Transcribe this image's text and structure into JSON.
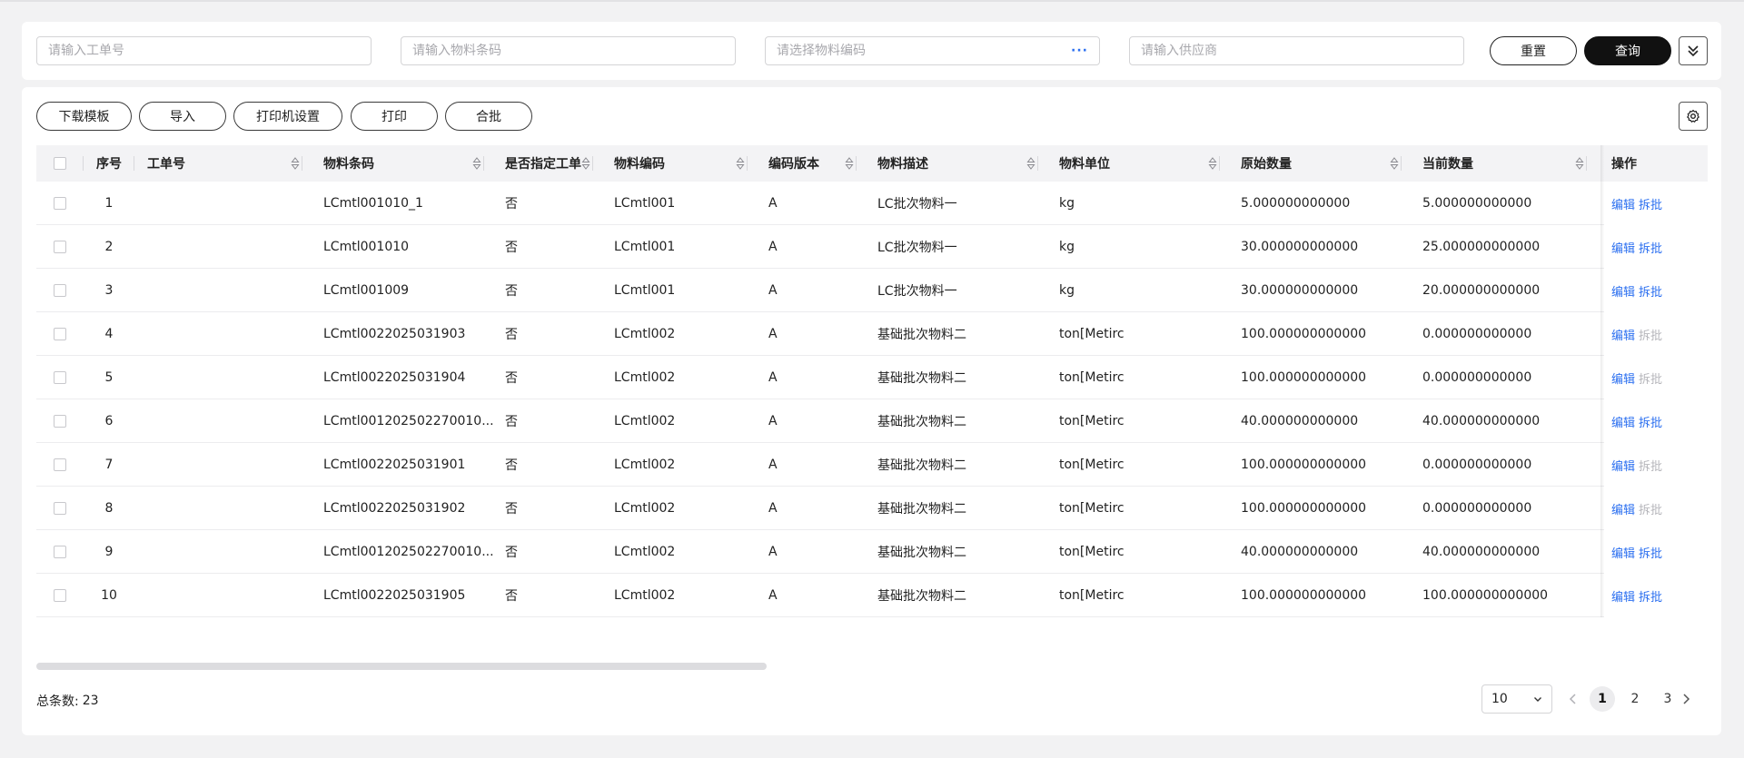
{
  "filters": {
    "work_order_placeholder": "请输入工单号",
    "material_barcode_placeholder": "请输入物料条码",
    "material_code_placeholder": "请选择物料编码",
    "supplier_placeholder": "请输入供应商",
    "reset_label": "重置",
    "query_label": "查询"
  },
  "toolbar": {
    "download_template": "下载模板",
    "import": "导入",
    "printer_settings": "打印机设置",
    "print": "打印",
    "merge_batch": "合批"
  },
  "table": {
    "columns": {
      "index": "序号",
      "work_order": "工单号",
      "material_barcode": "物料条码",
      "is_assigned_order": "是否指定工单",
      "material_code": "物料编码",
      "code_version": "编码版本",
      "material_desc": "物料描述",
      "material_unit": "物料单位",
      "original_qty": "原始数量",
      "current_qty": "当前数量",
      "actions": "操作"
    },
    "edit_label": "编辑",
    "split_label": "拆批",
    "rows": [
      {
        "index": "1",
        "work_order": "",
        "barcode": "LCmtl001010_1",
        "assigned": "否",
        "code": "LCmtl001",
        "version": "A",
        "desc": "LC批次物料一",
        "unit": "kg",
        "orig": "5.000000000000",
        "curr": "5.000000000000",
        "split_enabled": true
      },
      {
        "index": "2",
        "work_order": "",
        "barcode": "LCmtl001010",
        "assigned": "否",
        "code": "LCmtl001",
        "version": "A",
        "desc": "LC批次物料一",
        "unit": "kg",
        "orig": "30.000000000000",
        "curr": "25.000000000000",
        "split_enabled": true
      },
      {
        "index": "3",
        "work_order": "",
        "barcode": "LCmtl001009",
        "assigned": "否",
        "code": "LCmtl001",
        "version": "A",
        "desc": "LC批次物料一",
        "unit": "kg",
        "orig": "30.000000000000",
        "curr": "20.000000000000",
        "split_enabled": true
      },
      {
        "index": "4",
        "work_order": "",
        "barcode": "LCmtl0022025031903",
        "assigned": "否",
        "code": "LCmtl002",
        "version": "A",
        "desc": "基础批次物料二",
        "unit": "ton[Metirc",
        "orig": "100.000000000000",
        "curr": "0.000000000000",
        "split_enabled": false
      },
      {
        "index": "5",
        "work_order": "",
        "barcode": "LCmtl0022025031904",
        "assigned": "否",
        "code": "LCmtl002",
        "version": "A",
        "desc": "基础批次物料二",
        "unit": "ton[Metirc",
        "orig": "100.000000000000",
        "curr": "0.000000000000",
        "split_enabled": false
      },
      {
        "index": "6",
        "work_order": "",
        "barcode": "LCmtl001202502270010...",
        "assigned": "否",
        "code": "LCmtl002",
        "version": "A",
        "desc": "基础批次物料二",
        "unit": "ton[Metirc",
        "orig": "40.000000000000",
        "curr": "40.000000000000",
        "split_enabled": true
      },
      {
        "index": "7",
        "work_order": "",
        "barcode": "LCmtl0022025031901",
        "assigned": "否",
        "code": "LCmtl002",
        "version": "A",
        "desc": "基础批次物料二",
        "unit": "ton[Metirc",
        "orig": "100.000000000000",
        "curr": "0.000000000000",
        "split_enabled": false
      },
      {
        "index": "8",
        "work_order": "",
        "barcode": "LCmtl0022025031902",
        "assigned": "否",
        "code": "LCmtl002",
        "version": "A",
        "desc": "基础批次物料二",
        "unit": "ton[Metirc",
        "orig": "100.000000000000",
        "curr": "0.000000000000",
        "split_enabled": false
      },
      {
        "index": "9",
        "work_order": "",
        "barcode": "LCmtl001202502270010...",
        "assigned": "否",
        "code": "LCmtl002",
        "version": "A",
        "desc": "基础批次物料二",
        "unit": "ton[Metirc",
        "orig": "40.000000000000",
        "curr": "40.000000000000",
        "split_enabled": true
      },
      {
        "index": "10",
        "work_order": "",
        "barcode": "LCmtl0022025031905",
        "assigned": "否",
        "code": "LCmtl002",
        "version": "A",
        "desc": "基础批次物料二",
        "unit": "ton[Metirc",
        "orig": "100.000000000000",
        "curr": "100.000000000000",
        "split_enabled": true
      }
    ]
  },
  "footer": {
    "total_label": "总条数:",
    "total_count": "23",
    "page_size": "10",
    "pages": [
      "1",
      "2",
      "3"
    ],
    "current_page": "1"
  },
  "colors": {
    "link": "#2b6ff0",
    "link_disabled": "#b6b6bb",
    "primary_button": "#111111"
  },
  "icons": {
    "material_code_picker": "ellipsis-icon",
    "expand": "double-chevron-down-icon",
    "settings": "gear-icon",
    "sort": "sort-icon",
    "page_size_dropdown": "chevron-down-icon",
    "prev_page": "chevron-left-icon",
    "next_page": "chevron-right-icon"
  }
}
